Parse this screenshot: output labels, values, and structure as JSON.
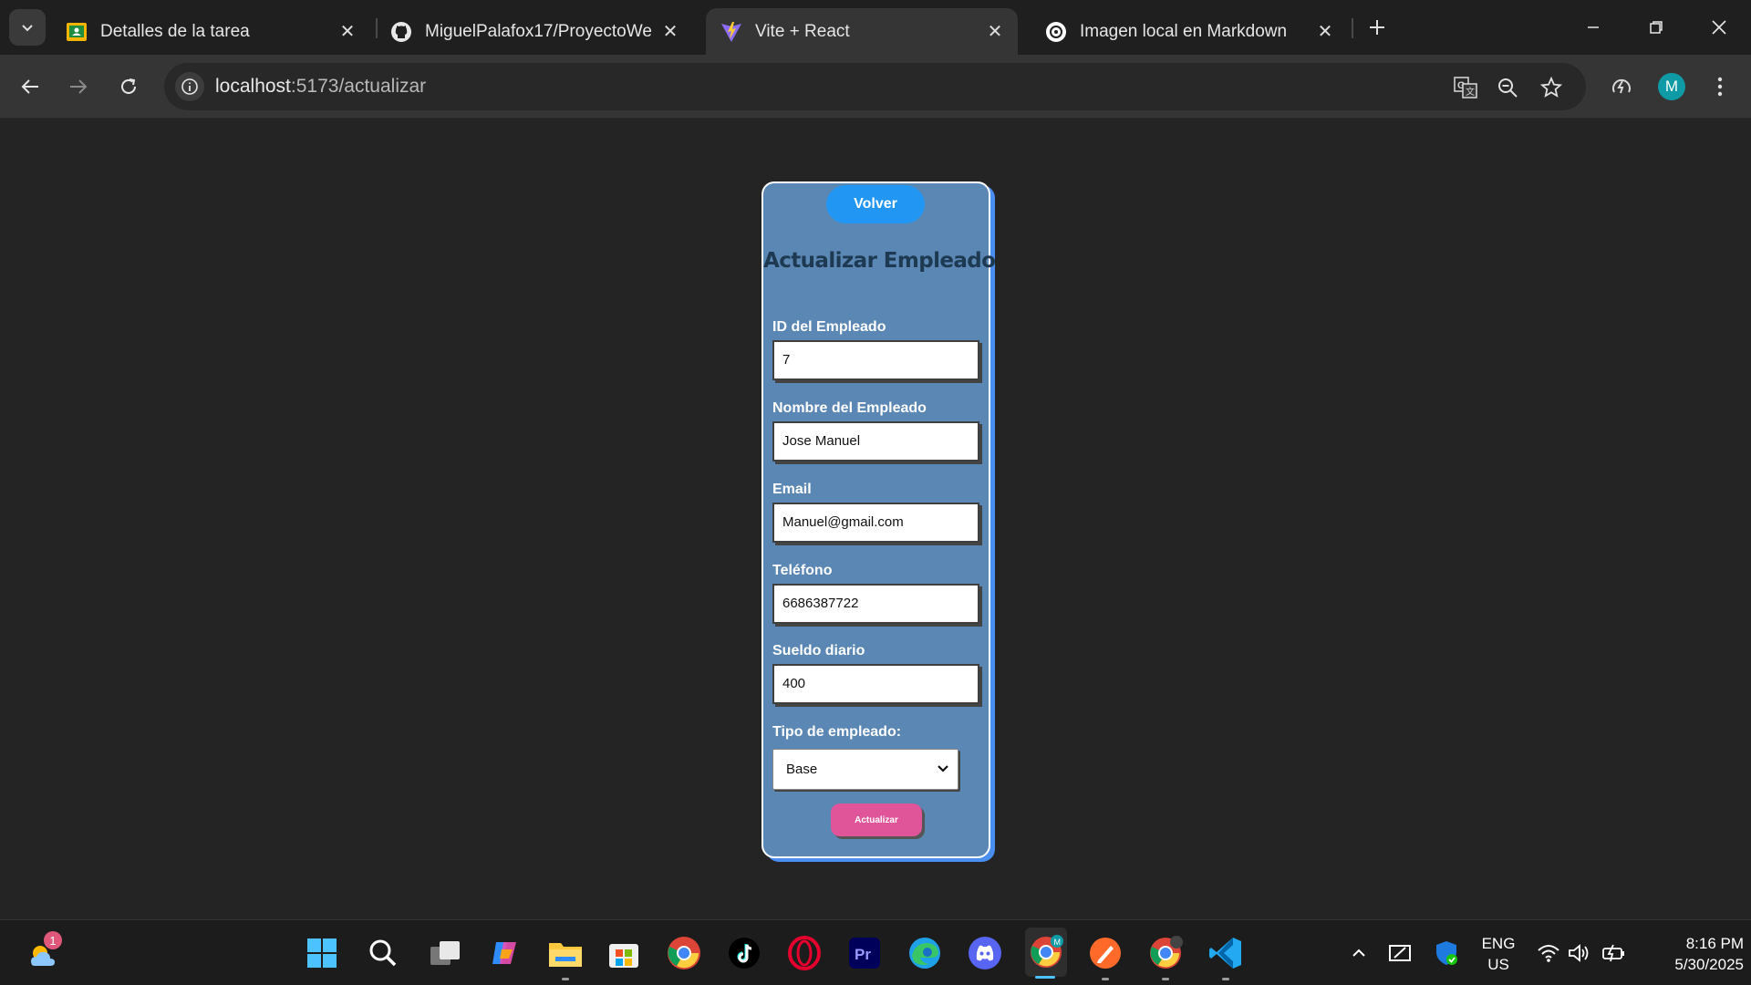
{
  "browser": {
    "tabs": [
      {
        "title": "Detalles de la tarea",
        "icon": "classroom-icon",
        "active": false
      },
      {
        "title": "MiguelPalafox17/ProyectoWeb",
        "icon": "github-icon",
        "active": false
      },
      {
        "title": "Vite + React",
        "icon": "vite-icon",
        "active": true
      },
      {
        "title": "Imagen local en Markdown",
        "icon": "chatgpt-icon",
        "active": false
      }
    ],
    "url_host": "localhost",
    "url_path": ":5173/actualizar",
    "profile_initial": "M"
  },
  "form": {
    "back_label": "Volver",
    "title": "Actualizar Empleado",
    "fields": [
      {
        "label": "ID del Empleado",
        "value": "7"
      },
      {
        "label": "Nombre del Empleado",
        "value": "Jose Manuel"
      },
      {
        "label": "Email",
        "value": "Manuel@gmail.com"
      },
      {
        "label": "Teléfono",
        "value": "6686387722"
      },
      {
        "label": "Sueldo diario",
        "value": "400"
      }
    ],
    "type_label": "Tipo de empleado:",
    "type_value": "Base",
    "submit_label": "Actualizar"
  },
  "taskbar": {
    "weather_badge": "1",
    "language_line1": "ENG",
    "language_line2": "US",
    "time": "8:16 PM",
    "date": "5/30/2025"
  },
  "colors": {
    "card_bg": "#5b87b4",
    "volver_button": "#2196f3",
    "actualizar_button": "#e0559a",
    "title_text": "#1e3a52"
  }
}
